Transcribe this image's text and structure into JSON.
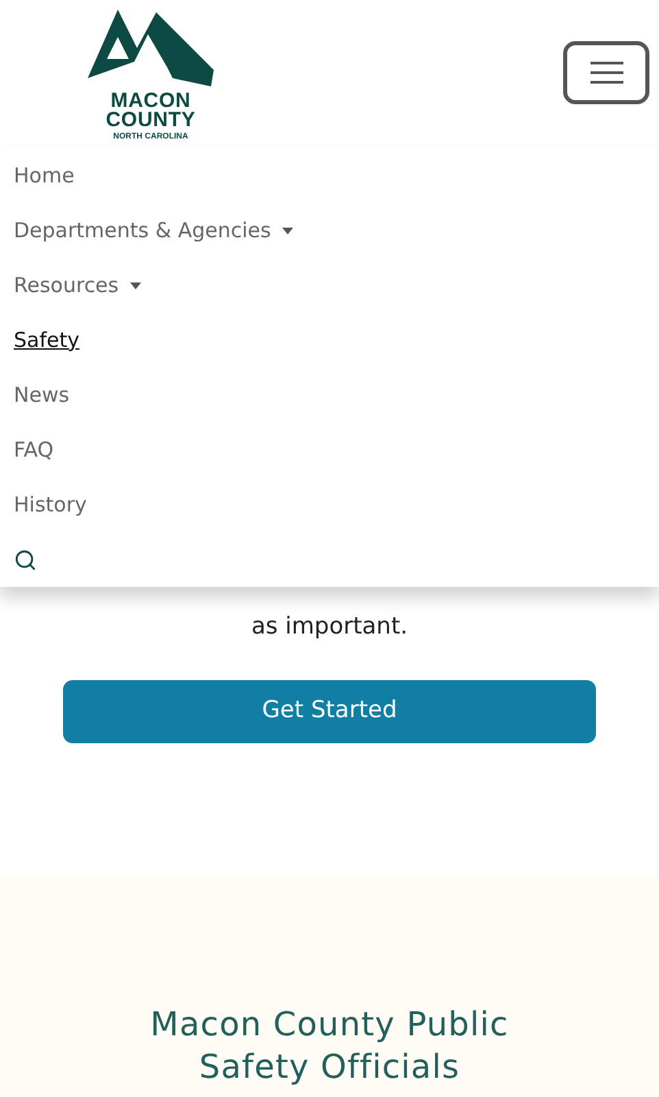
{
  "logo": {
    "line_1": "MACON",
    "line_2": "COUNTY",
    "line_3": "NORTH CAROLINA"
  },
  "nav": {
    "items": [
      {
        "label": "Home",
        "kind": "link",
        "selected": false
      },
      {
        "label": "Departments & Agencies",
        "kind": "dropdown",
        "selected": false
      },
      {
        "label": "Resources",
        "kind": "dropdown",
        "selected": false
      },
      {
        "label": "Safety",
        "kind": "link",
        "selected": true
      },
      {
        "label": "News",
        "kind": "link",
        "selected": false
      },
      {
        "label": "FAQ",
        "kind": "link",
        "selected": false
      },
      {
        "label": "History",
        "kind": "link",
        "selected": false
      },
      {
        "kind": "search",
        "selected": false
      }
    ]
  },
  "intro": {
    "lines": [
      "as important."
    ],
    "button": "Get Started"
  },
  "officials": {
    "heading_lines": [
      "Macon County Public",
      "Safety Officials"
    ]
  }
}
